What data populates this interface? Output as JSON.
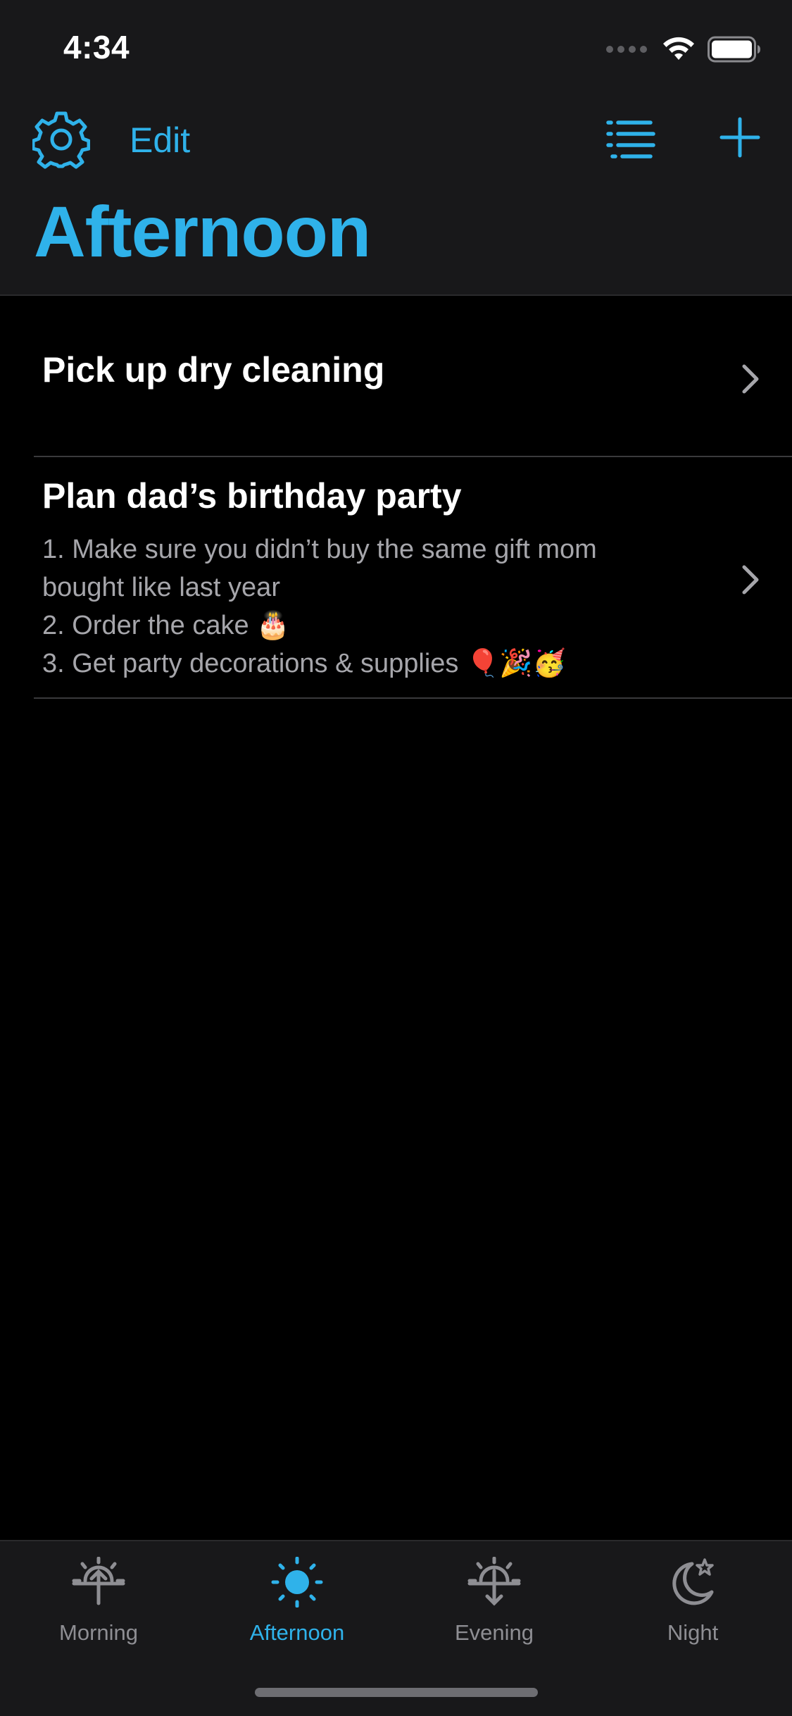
{
  "status_bar": {
    "time": "4:34"
  },
  "nav": {
    "edit_label": "Edit",
    "title": "Afternoon"
  },
  "reminders": [
    {
      "title": "Pick up dry cleaning",
      "notes": []
    },
    {
      "title": "Plan dad’s birthday party",
      "notes": [
        "1. Make sure you didn’t buy the same gift mom",
        "bought like last year",
        "2. Order the cake 🎂",
        "3. Get party decorations & supplies 🎈🎉🥳"
      ]
    }
  ],
  "tabs": [
    {
      "label": "Morning",
      "icon": "sunrise-icon",
      "active": false
    },
    {
      "label": "Afternoon",
      "icon": "sun-icon",
      "active": true
    },
    {
      "label": "Evening",
      "icon": "sunset-icon",
      "active": false
    },
    {
      "label": "Night",
      "icon": "moon-star-icon",
      "active": false
    }
  ],
  "colors": {
    "accent": "#2fb2ea",
    "background": "#000000",
    "bar_background": "#18181a",
    "inactive": "#8e8e93",
    "note_text": "#a6a6ab"
  }
}
